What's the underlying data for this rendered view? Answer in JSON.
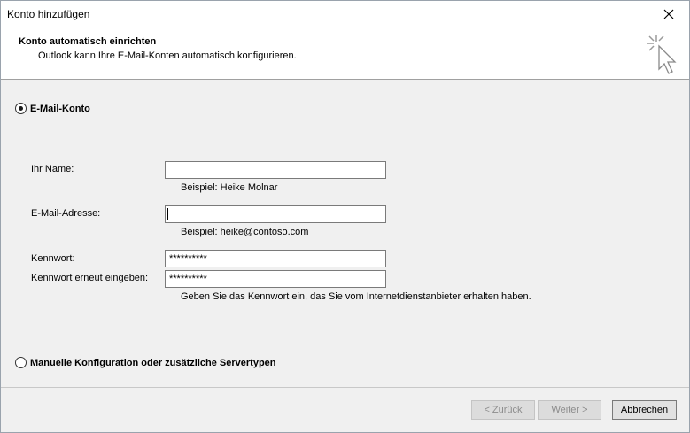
{
  "window": {
    "title": "Konto hinzufügen"
  },
  "header": {
    "title": "Konto automatisch einrichten",
    "subtitle": "Outlook kann Ihre E-Mail-Konten automatisch konfigurieren."
  },
  "options": {
    "email_account": {
      "label": "E-Mail-Konto",
      "selected": true
    },
    "manual": {
      "label": "Manuelle Konfiguration oder zusätzliche Servertypen",
      "selected": false
    }
  },
  "form": {
    "name": {
      "label": "Ihr Name:",
      "value": "",
      "hint": "Beispiel: Heike Molnar"
    },
    "email": {
      "label": "E-Mail-Adresse:",
      "value": "",
      "hint": "Beispiel: heike@contoso.com"
    },
    "password": {
      "label": "Kennwort:",
      "value": "**********"
    },
    "password_confirm": {
      "label": "Kennwort erneut eingeben:",
      "value": "**********",
      "hint": "Geben Sie das Kennwort ein, das Sie vom Internetdienstanbieter erhalten haben."
    }
  },
  "buttons": {
    "back": "< Zurück",
    "next": "Weiter >",
    "cancel": "Abbrechen"
  },
  "icons": {
    "close": "close-icon",
    "wizard": "magic-cursor-icon"
  }
}
